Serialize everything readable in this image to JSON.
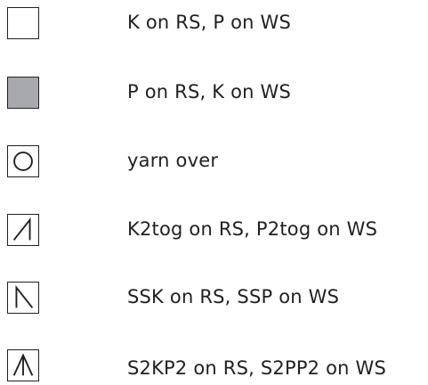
{
  "legend": {
    "items": [
      {
        "symbol": "knit-square",
        "label": "K on RS, P on WS"
      },
      {
        "symbol": "purl-square",
        "label": "P on RS, K on WS"
      },
      {
        "symbol": "yarn-over-circle",
        "label": "yarn over"
      },
      {
        "symbol": "k2tog-slash",
        "label": "K2tog on RS, P2tog on WS"
      },
      {
        "symbol": "ssk-backslash",
        "label": "SSK on RS, SSP on WS"
      },
      {
        "symbol": "s2kp2-caret",
        "label": "S2KP2 on RS, S2PP2 on WS"
      }
    ],
    "colors": {
      "stroke": "#231f20",
      "purl_fill": "#a7a9ac",
      "background": "#ffffff"
    }
  }
}
